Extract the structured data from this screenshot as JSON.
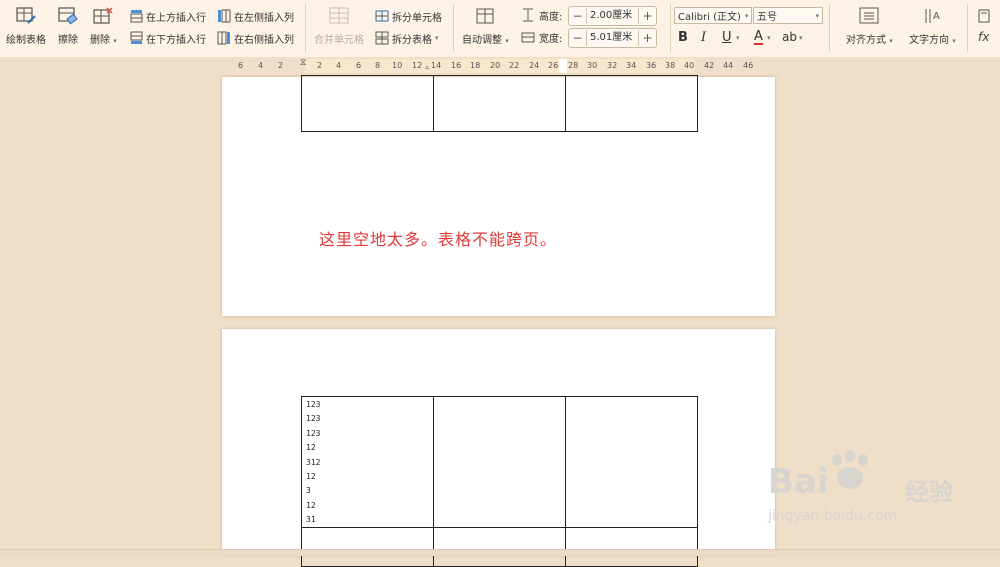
{
  "ribbon": {
    "draw_table": "绘制表格",
    "erase": "擦除",
    "delete": "删除",
    "insert_row_above": "在上方插入行",
    "insert_row_below": "在下方插入行",
    "insert_col_left": "在左侧插入列",
    "insert_col_right": "在右侧插入列",
    "merge_cells": "合并单元格",
    "split_cells": "拆分单元格",
    "split_table": "拆分表格",
    "auto_fit": "自动调整",
    "height_label": "高度:",
    "height_value": "2.00厘米",
    "width_label": "宽度:",
    "width_value": "5.01厘米",
    "font_name": "Calibri (正文)",
    "font_size": "五号",
    "bold": "B",
    "italic": "I",
    "underline": "U",
    "font_color": "A",
    "highlight": "ab",
    "align": "对齐方式",
    "text_direction": "文字方向",
    "formula_icon": "fx",
    "plus": "+",
    "minus": "−",
    "dropdown_caret": "▾"
  },
  "ruler": {
    "left_ticks": [
      "6",
      "4",
      "2"
    ],
    "right_ticks": [
      "2",
      "4",
      "6",
      "8",
      "10",
      "12",
      "14",
      "16",
      "18",
      "20",
      "22",
      "24",
      "26",
      "28",
      "30",
      "32",
      "34",
      "36",
      "38",
      "40",
      "42",
      "44",
      "46"
    ]
  },
  "document": {
    "note": "这里空地太多。表格不能跨页。",
    "cell_lines": [
      "123",
      "123",
      "123",
      "12",
      "312",
      "12",
      "3",
      "12",
      "31"
    ]
  },
  "watermark": {
    "brand": "Bai",
    "brand2": "经验",
    "url": "jingyan.baidu.com"
  },
  "colors": {
    "accent_note": "#e03a3a",
    "ribbon_bg": "#fcf3e6",
    "workspace_bg": "#efdfc8"
  }
}
